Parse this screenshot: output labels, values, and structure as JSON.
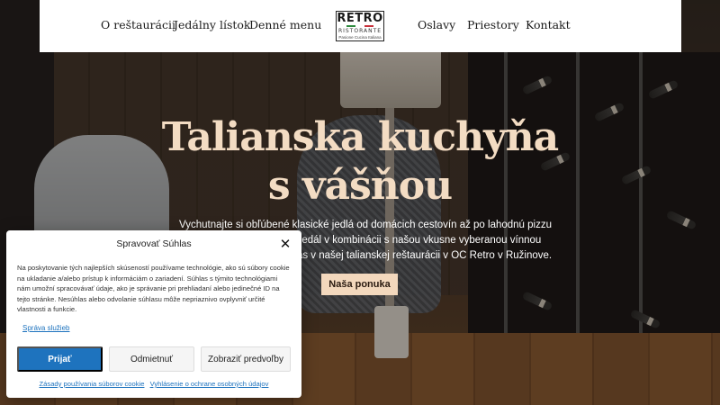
{
  "nav": {
    "left": [
      "O reštaurácii",
      "Jedálny lístok",
      "Denné menu"
    ],
    "right": [
      "Oslavy",
      "Priestory",
      "Kontakt"
    ]
  },
  "logo": {
    "name": "RETRO",
    "subtitle": "RISTORANTE",
    "tagline": "Pasione Cucina Italiana"
  },
  "hero": {
    "title_line1": "Talianska kuchyňa",
    "title_line2": "s vášňou",
    "description": "Vychutnajte si obľúbené klasické jedlá od domácich cestovín až po lahodnú pizzu a množstvo moderných jedál v kombinácii s našou vkusne vyberanou vínnou kartou. Ochutnajte ich u nás v našej talianskej reštaurácii v OC Retro v Ružinove.",
    "cta_label": "Naša ponuka",
    "title_color": "#f3dcc3",
    "cta_color": "#f3d8bd"
  },
  "cookie": {
    "title": "Spravovať Súhlas",
    "close_icon": "close-icon",
    "text": "Na poskytovanie tých najlepších skúseností používame technológie, ako sú súbory cookie na ukladanie a/alebo prístup k informáciám o zariadení. Súhlas s týmito technológiami nám umožní spracovávať údaje, ako je správanie pri prehliadaní alebo jedinečné ID na tejto stránke. Nesúhlas alebo odvolanie súhlasu môže nepriaznivo ovplyvniť určité vlastnosti a funkcie.",
    "manage_label": "Správa služieb",
    "accept_label": "Prijať",
    "deny_label": "Odmietnuť",
    "prefs_label": "Zobraziť predvoľby",
    "link_cookie_policy": "Zásady používania súborov cookie",
    "link_privacy": "Vyhlásenie o ochrane osobných údajov",
    "accent_color": "#1e73be"
  }
}
